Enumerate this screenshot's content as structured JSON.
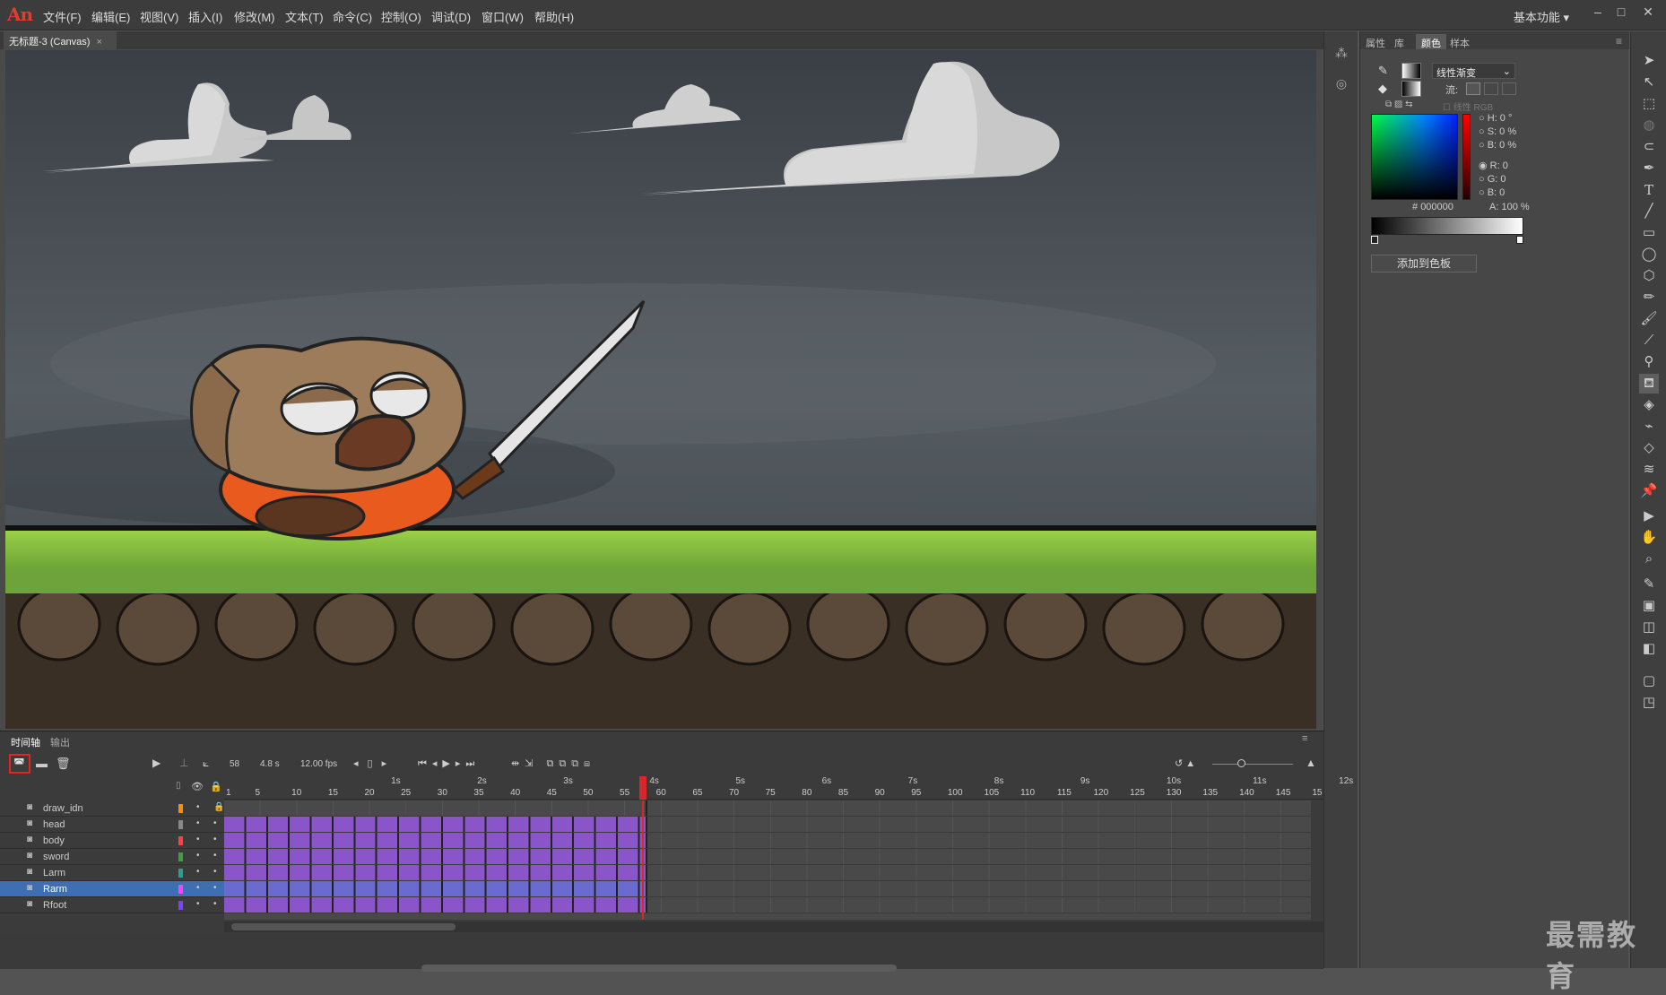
{
  "app": {
    "logo": "An"
  },
  "menu": [
    "文件(F)",
    "编辑(E)",
    "视图(V)",
    "插入(I)",
    "修改(M)",
    "文本(T)",
    "命令(C)",
    "控制(O)",
    "调试(D)",
    "窗口(W)",
    "帮助(H)"
  ],
  "workspace": "基本功能",
  "document_tab": "无标题-3 (Canvas)",
  "panel_tabs": [
    "属性",
    "库",
    "颜色",
    "样本"
  ],
  "color_panel": {
    "fill_type": "线性渐变",
    "flow_label": "流:",
    "linear_rgb": "线性 RGB",
    "H": "0 °",
    "S": "0 %",
    "B": "0 %",
    "R": "0",
    "G": "0",
    "Bv": "0",
    "hex": "000000",
    "alpha": "100 %",
    "add_swatch": "添加到色板",
    "accent": "#e03c31"
  },
  "timeline": {
    "tabs": [
      "时间轴",
      "输出"
    ],
    "frame": "58",
    "time": "4.8 s",
    "fps": "12.00 fps",
    "seconds": [
      "1s",
      "2s",
      "3s",
      "4s",
      "5s",
      "6s",
      "7s",
      "8s",
      "9s",
      "10s",
      "11s",
      "12s"
    ],
    "frame_ticks": [
      "1",
      "5",
      "10",
      "15",
      "20",
      "25",
      "30",
      "35",
      "40",
      "45",
      "50",
      "55",
      "60",
      "65",
      "70",
      "75",
      "80",
      "85",
      "90",
      "95",
      "100",
      "105",
      "110",
      "115",
      "120",
      "125",
      "130",
      "135",
      "140",
      "145",
      "15"
    ],
    "layers": [
      {
        "name": "draw_idn",
        "color": "#ff8c00"
      },
      {
        "name": "head",
        "color": "#888888"
      },
      {
        "name": "body",
        "color": "#ff4040"
      },
      {
        "name": "sword",
        "color": "#40a040"
      },
      {
        "name": "Larm",
        "color": "#2aa090"
      },
      {
        "name": "Rarm",
        "color": "#ff40ff"
      },
      {
        "name": "Rfoot",
        "color": "#8040ff"
      }
    ]
  },
  "watermark": "最需教育"
}
